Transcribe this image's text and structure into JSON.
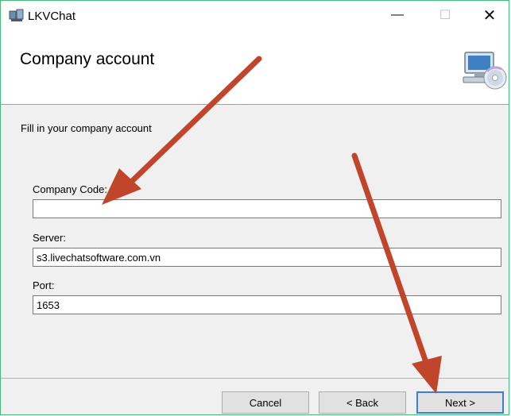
{
  "window": {
    "title": "LKVChat",
    "minimize_symbol": "—",
    "maximize_symbol": "☐",
    "close_symbol": "✕"
  },
  "header": {
    "title": "Company account",
    "icon": "computer-cd-icon"
  },
  "content": {
    "instruction": "Fill in your company account",
    "fields": {
      "company_code": {
        "label": "Company Code:",
        "value": ""
      },
      "server": {
        "label": "Server:",
        "value": "s3.livechatsoftware.com.vn"
      },
      "port": {
        "label": "Port:",
        "value": "1653"
      }
    }
  },
  "footer": {
    "cancel_label": "Cancel",
    "back_label": "< Back",
    "next_label": "Next >"
  },
  "colors": {
    "window_border": "#48b878",
    "annotation_arrow": "#c0452a",
    "default_button_border": "#3c7fd1"
  }
}
